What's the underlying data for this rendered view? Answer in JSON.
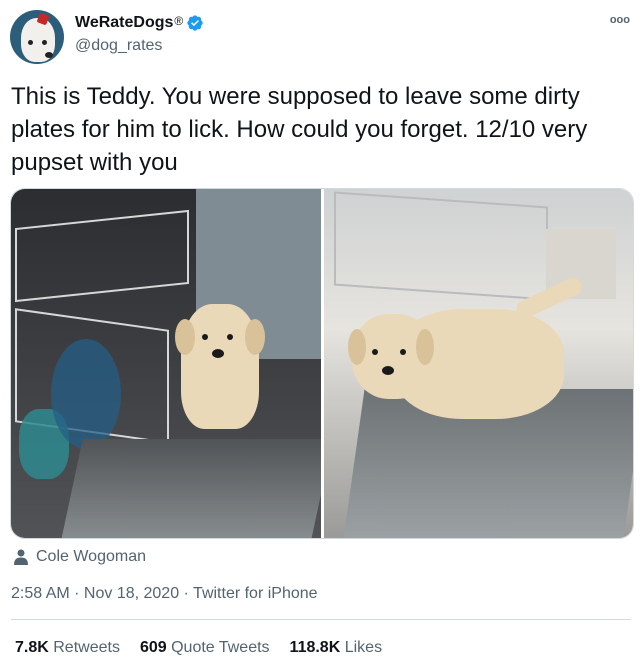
{
  "author": {
    "display_name": "WeRateDogs",
    "registered_mark": "®",
    "handle": "@dog_rates",
    "avatar_icon": "dog-avatar",
    "verified_icon": "verified-badge-icon",
    "verified_color": "#1d9bf0"
  },
  "more_icon": "ooo",
  "tweet": {
    "text": "This is Teddy. You were supposed to leave some dirty plates for him to lick. How could you forget. 12/10 very pupset with you"
  },
  "media": {
    "photos": [
      "puppy-in-dishwasher-photo",
      "puppy-on-dishwasher-door-photo"
    ]
  },
  "credit": {
    "icon": "person-icon",
    "name": "Cole Wogoman"
  },
  "meta": {
    "time": "2:58 AM",
    "separator1": " · ",
    "date": "Nov 18, 2020",
    "separator2": " · ",
    "source": "Twitter for iPhone"
  },
  "stats": {
    "retweets_count": "7.8K",
    "retweets_label": "Retweets",
    "quotes_count": "609",
    "quotes_label": "Quote Tweets",
    "likes_count": "118.8K",
    "likes_label": "Likes"
  },
  "colors": {
    "text_primary": "#0f1419",
    "text_secondary": "#536471",
    "border": "#cfd9de"
  }
}
